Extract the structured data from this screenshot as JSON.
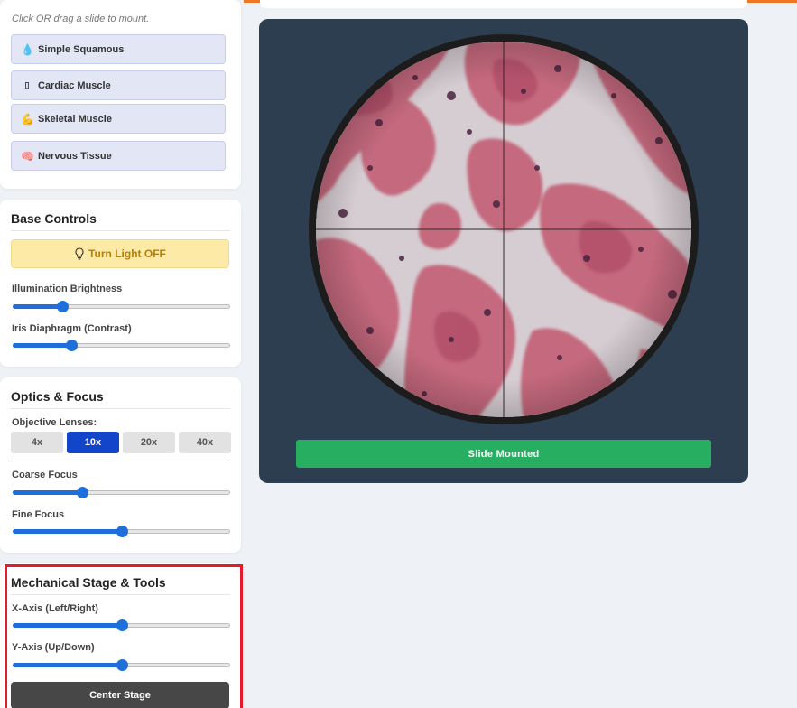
{
  "slides": {
    "hint": "Click OR drag a slide to mount.",
    "items": [
      {
        "label": "Simple Squamous",
        "icon": "blood-drop-icon",
        "glyph": "🩸"
      },
      {
        "label": "Cardiac Muscle",
        "icon": "heart-icon",
        "glyph": "▯"
      },
      {
        "label": "Skeletal Muscle",
        "icon": "flexed-arm-icon",
        "glyph": "💪"
      },
      {
        "label": "Nervous Tissue",
        "icon": "brain-icon",
        "glyph": "🧠"
      }
    ]
  },
  "base_controls": {
    "title": "Base Controls",
    "light_button": "Turn Light OFF",
    "brightness_label": "Illumination Brightness",
    "brightness_value": 0.23,
    "iris_label": "Iris Diaphragm (Contrast)",
    "iris_value": 0.27
  },
  "optics": {
    "title": "Optics & Focus",
    "lenses_label": "Objective Lenses:",
    "lenses": [
      "4x",
      "10x",
      "20x",
      "40x"
    ],
    "active_lens": "10x",
    "coarse_label": "Coarse Focus",
    "coarse_value": 0.32,
    "fine_label": "Fine Focus",
    "fine_value": 0.5
  },
  "stage": {
    "title": "Mechanical Stage & Tools",
    "x_label": "X-Axis (Left/Right)",
    "x_value": 0.5,
    "y_label": "Y-Axis (Up/Down)",
    "y_value": 0.5,
    "center_button": "Center Stage"
  },
  "viewer": {
    "status": "Slide Mounted"
  },
  "colors": {
    "accent": "#1e6fd9",
    "active_lens": "#1245c9",
    "status_green": "#27ae60",
    "viewer_bg": "#2d3e50",
    "highlight": "#e51a2b",
    "top_accent": "#f07722"
  }
}
